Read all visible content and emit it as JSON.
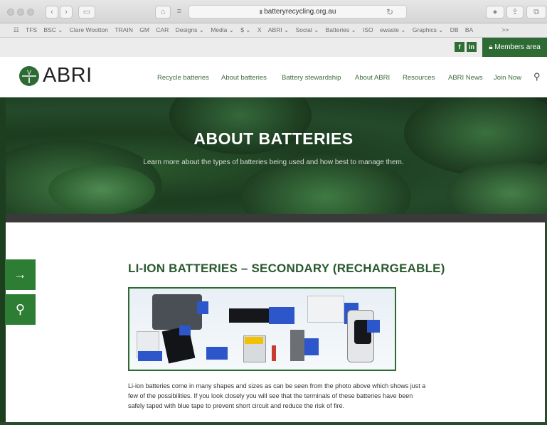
{
  "browser": {
    "url": "batteryrecycling.org.au",
    "bookmarks": [
      "TFS",
      "BSC ⌄",
      "Clare Wootton",
      "TRAIN",
      "GM",
      "CAR",
      "Designs ⌄",
      "Media ⌄",
      "$ ⌄",
      "X",
      "ABRI ⌄",
      "Social ⌄",
      "Batteries ⌄",
      "ISO",
      "ewaste ⌄",
      "Graphics ⌄",
      "DB",
      "BA"
    ],
    "bookmarks_more": ">>"
  },
  "site": {
    "social_facebook": "f",
    "social_linkedin": "in",
    "members_label": "Members area",
    "logo_text": "ABRI",
    "nav": [
      "Recycle batteries",
      "About batteries",
      "Battery stewardship",
      "About ABRI",
      "Resources",
      "ABRI News",
      "Join Now"
    ]
  },
  "hero": {
    "title": "ABOUT BATTERIES",
    "subtitle": "Learn more about the types of batteries being used and how best to manage them."
  },
  "content": {
    "section_title": "LI-ION BATTERIES – SECONDARY (RECHARGEABLE)",
    "paragraph": "Li-ion batteries come in many shapes and sizes as can be seen from the photo above which shows just a few of the possibilities.  If you look closely you will see that the terminals of these batteries have been safely taped with blue tape to prevent short circuit and reduce the risk of fire."
  },
  "side_buttons": [
    "→",
    "⚲"
  ]
}
